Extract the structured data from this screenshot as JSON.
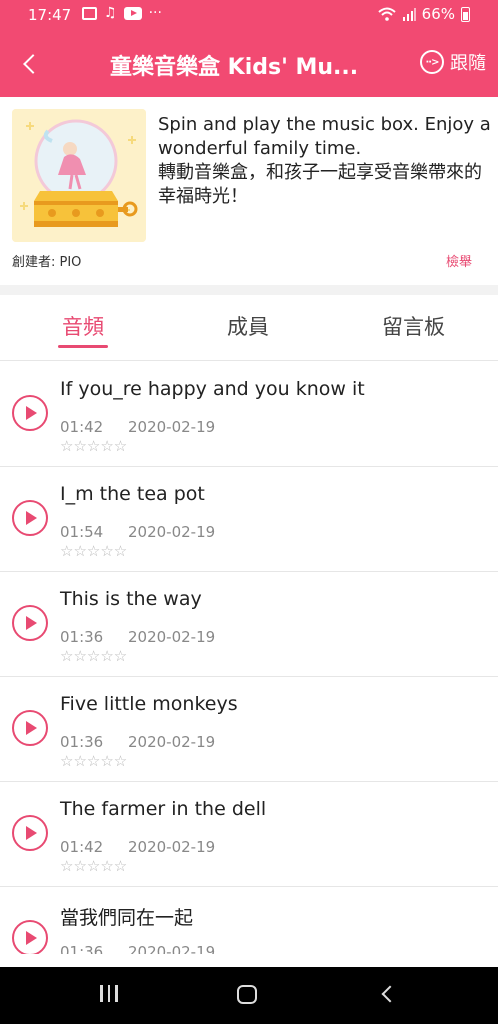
{
  "status_bar": {
    "time": "17:47",
    "dots": "···",
    "music_glyph": "♫",
    "battery": "66%"
  },
  "header": {
    "title": "童樂音樂盒 Kids' Mu...",
    "follow_label": "跟隨",
    "follow_icon_text": "··>"
  },
  "intro": {
    "description": "Spin and play the music box. Enjoy a wonderful family time.\n轉動音樂盒，和孩子一起享受音樂帶來的幸福時光！",
    "creator": "創建者: PIO",
    "report": "檢舉"
  },
  "tabs": [
    {
      "label": "音頻"
    },
    {
      "label": "成員"
    },
    {
      "label": "留言板"
    }
  ],
  "tracks": [
    {
      "title": "If you_re happy and you know it",
      "duration": "01:42",
      "date": "2020-02-19",
      "stars": "☆☆☆☆☆"
    },
    {
      "title": "I_m the tea pot",
      "duration": "01:54",
      "date": "2020-02-19",
      "stars": "☆☆☆☆☆"
    },
    {
      "title": "This is the way",
      "duration": "01:36",
      "date": "2020-02-19",
      "stars": "☆☆☆☆☆"
    },
    {
      "title": "Five little monkeys",
      "duration": "01:36",
      "date": "2020-02-19",
      "stars": "☆☆☆☆☆"
    },
    {
      "title": "The farmer in the dell",
      "duration": "01:42",
      "date": "2020-02-19",
      "stars": "☆☆☆☆☆"
    },
    {
      "title": "當我們同在一起",
      "duration": "01:36",
      "date": "2020-02-19",
      "stars": "☆☆☆☆☆"
    }
  ],
  "colors": {
    "accent": "#f24a72",
    "text": "#222222",
    "muted": "#888888"
  }
}
